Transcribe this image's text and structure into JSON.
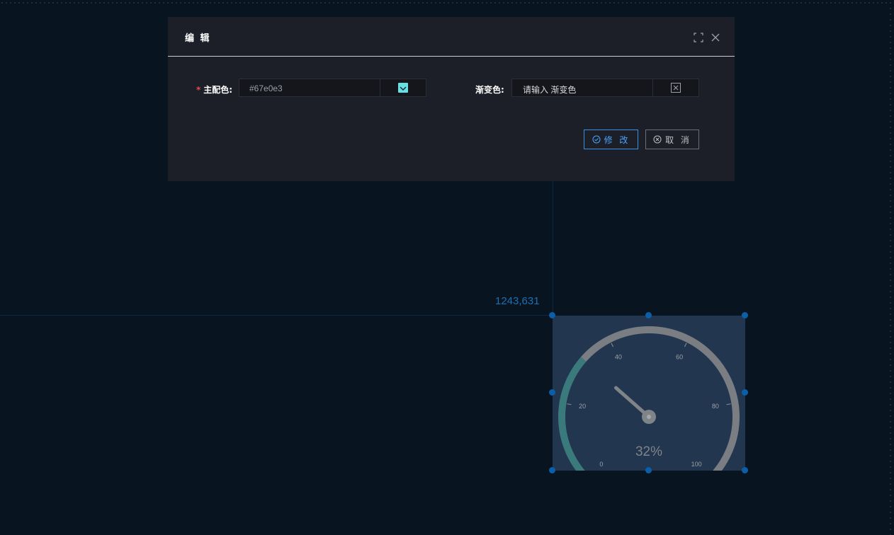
{
  "dialog": {
    "title": "编 辑",
    "fullscreen_icon": "fullscreen-icon",
    "close_icon": "close-icon",
    "primary_color": {
      "label": "主配色:",
      "required_mark": "*",
      "value": "#67e0e3",
      "swatch_color": "#67e0e3",
      "picker_icon": "chevron-down-icon"
    },
    "gradient_color": {
      "label": "渐变色:",
      "placeholder": "请输入 渐变色",
      "picker_icon": "empty-color-icon"
    },
    "buttons": {
      "submit": "修 改",
      "cancel": "取 消"
    }
  },
  "canvas": {
    "coordinate_readout": "1243,631"
  },
  "colors": {
    "accent": "#4aa3ff",
    "gauge_track": "#7a7e82",
    "gauge_fill": "#3a7a7c",
    "widget_bg": "#22364f"
  },
  "chart_data": {
    "type": "gauge",
    "value": 32,
    "unit": "%",
    "value_label": "32%",
    "min": 0,
    "max": 100,
    "ticks": [
      "0",
      "20",
      "40",
      "60",
      "80",
      "100"
    ]
  }
}
